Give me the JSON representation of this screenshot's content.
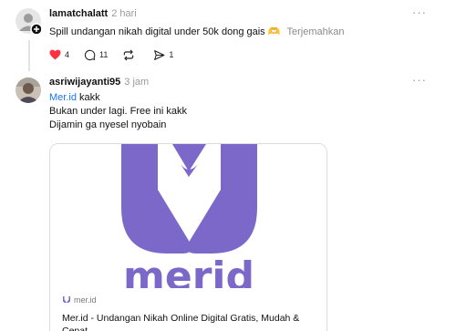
{
  "post1": {
    "username": "lamatchalatt",
    "time": "2 hari",
    "text": "Spill undangan nikah digital under 50k dong gais",
    "emoji": "🫶",
    "translate_label": "Terjemahkan",
    "more_label": "···",
    "likes": "4",
    "replies": "11",
    "shares": "1",
    "liked": true
  },
  "post2": {
    "username": "asriwijayanti95",
    "time": "3 jam",
    "more_label": "···",
    "mention": "Mer.id",
    "line1_rest": " kakk",
    "line2": "Bukan under lagi. Free ini kakk",
    "line3": "Dijamin ga nyesel nyobain"
  },
  "link_card": {
    "logo_text": "merid",
    "domain": "mer.id",
    "title": "Mer.id - Undangan Nikah Online Digital Gratis, Mudah & Cepat"
  },
  "colors": {
    "like": "#ff3040",
    "link": "#1877f2",
    "brand": "#7b68c8"
  }
}
